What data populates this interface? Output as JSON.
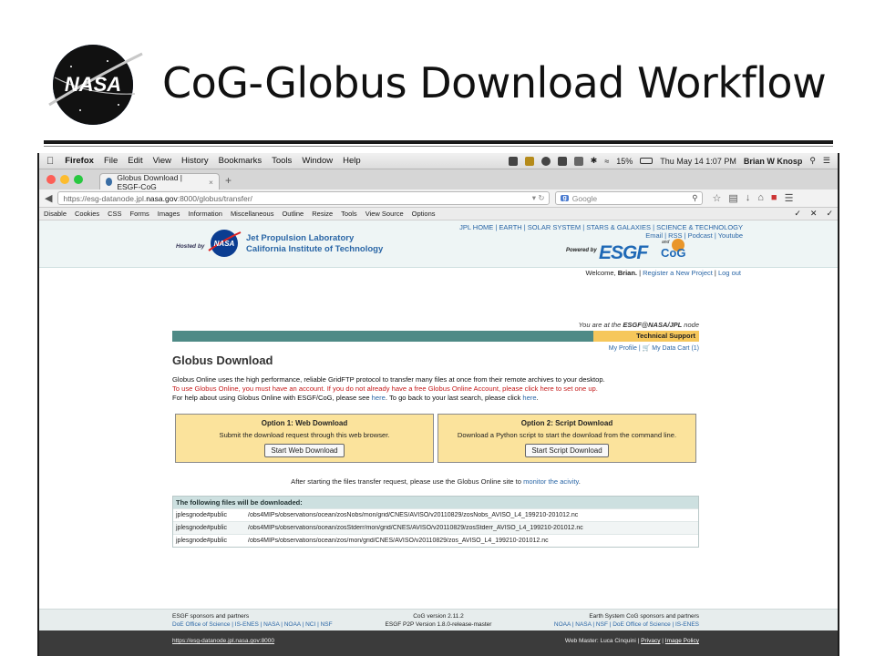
{
  "slide": {
    "title": "CoG-Globus Download Workflow",
    "logo_text": "NASA"
  },
  "mac_menu": {
    "app": "Firefox",
    "items": [
      "File",
      "Edit",
      "View",
      "History",
      "Bookmarks",
      "Tools",
      "Window",
      "Help"
    ],
    "battery": "15%",
    "datetime": "Thu May 14  1:07 PM",
    "user": "Brian W Knosp"
  },
  "browser": {
    "tab_title": "Globus Download | ESGF-CoG",
    "url_prefix": "https://esg-datanode.jpl.",
    "url_host": "nasa.gov",
    "url_suffix": ":8000/globus/transfer/",
    "search_placeholder": "Google",
    "search_engine_badge": "g"
  },
  "devbar": {
    "items": [
      "Disable",
      "Cookies",
      "CSS",
      "Forms",
      "Images",
      "Information",
      "Miscellaneous",
      "Outline",
      "Resize",
      "Tools",
      "View Source",
      "Options"
    ]
  },
  "site": {
    "hosted_by": "Hosted by",
    "nasa_badge": "NASA",
    "jpl_line1": "Jet Propulsion Laboratory",
    "jpl_line2": "California Institute of Technology",
    "top_links_line1": "JPL HOME | EARTH | SOLAR SYSTEM | STARS & GALAXIES | SCIENCE & TECHNOLOGY",
    "top_links_line2": "Email | RSS | Podcast | Youtube",
    "powered_by": "Powered by",
    "esgf_logo": "ESGF",
    "cog_and": "and",
    "cog_logo": "CoG",
    "welcome_text": "Welcome, ",
    "welcome_name": "Brian.",
    "register_link": "Register a New Project",
    "logout_link": "Log out"
  },
  "page": {
    "node_prefix": "You are at the ",
    "node_name": "ESGF@NASA/JPL",
    "node_suffix": " node",
    "technical_support": "Technical Support",
    "my_profile": "My Profile",
    "my_cart": "My Data Cart (1)",
    "heading": "Globus Download",
    "intro": "Globus Online uses the high performance, reliable GridFTP protocol to transfer many files at once from their remote archives to your desktop.",
    "account_warning": "To use Globus Online, you must have an account. If you do not already have a free Globus Online Account, please click ",
    "account_link": "here",
    "account_suffix": " to set one up.",
    "help_text": "For help about using Globus Online with ESGF/CoG, please see ",
    "help_link": "here",
    "back_text": ".  To go back to your last search, please click ",
    "back_link": "here",
    "back_suffix": "."
  },
  "options": [
    {
      "title": "Option 1: Web Download",
      "desc": "Submit the download request through this web browser.",
      "button": "Start Web Download"
    },
    {
      "title": "Option 2: Script Download",
      "desc": "Download a Python script to start the download from the command line.",
      "button": "Start Script Download"
    }
  ],
  "after_text": "After starting the files transfer request, please use the Globus Online site to ",
  "after_link": "monitor the acivity",
  "after_suffix": ".",
  "files": {
    "header": "The following files will be downloaded:",
    "rows": [
      {
        "endpoint": "jplesgnode#public",
        "path": "/obs4MIPs/observations/ocean/zosNobs/mon/grid/CNES/AVISO/v20110829/zosNobs_AVISO_L4_199210-201012.nc"
      },
      {
        "endpoint": "jplesgnode#public",
        "path": "/obs4MIPs/observations/ocean/zosStderr/mon/grid/CNES/AVISO/v20110829/zosStderr_AVISO_L4_199210-201012.nc"
      },
      {
        "endpoint": "jplesgnode#public",
        "path": "/obs4MIPs/observations/ocean/zos/mon/grid/CNES/AVISO/v20110829/zos_AVISO_L4_199210-201012.nc"
      }
    ]
  },
  "footer": {
    "left_title": "ESGF sponsors and partners",
    "left_links": "DoE Office of Science | IS-ENES | NASA | NOAA | NCI | NSF",
    "mid_line1": "CoG version 2.11.2",
    "mid_line2": "ESGF P2P Version 1.8.0-release-master",
    "right_title": "Earth System CoG sponsors and partners",
    "right_links": "NOAA | NASA | NSF | DoE Office of Science | IS-ENES",
    "bottom_url": "https://esg-datanode.jpl.nasa.gov:8000",
    "webmaster": "Web Master: Luca Cinquini",
    "privacy": "Privacy",
    "image_policy": "Image Policy"
  },
  "colors": {
    "teal_bar": "#4e8a86",
    "tech_support": "#f6c75b",
    "option_box": "#fbe39c",
    "link": "#2a66a6",
    "warning": "#c41a1a"
  }
}
